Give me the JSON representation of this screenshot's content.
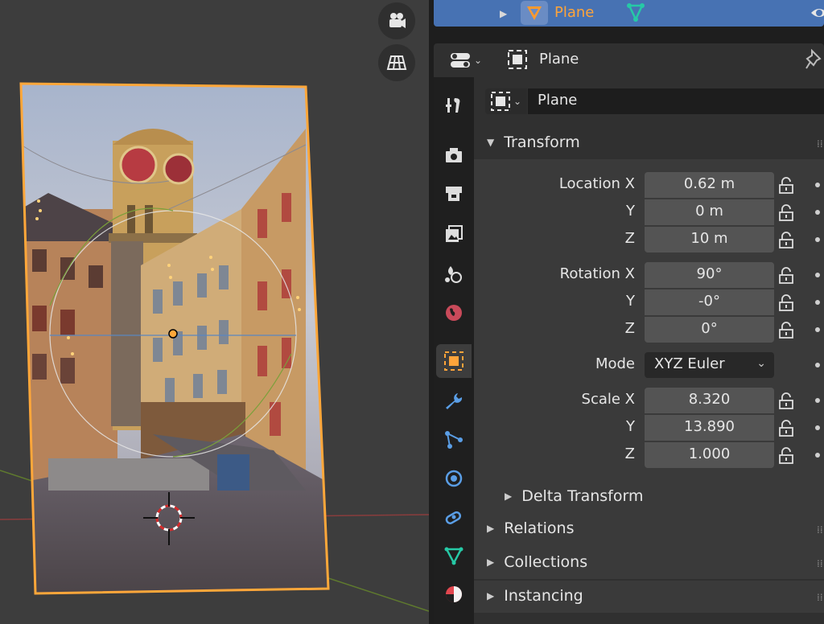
{
  "outliner": {
    "object_name": "Plane"
  },
  "properties": {
    "header_title": "Plane",
    "datablock_name": "Plane",
    "tabs": [
      "tool-icon",
      "render-icon",
      "output-icon",
      "view-layer-icon",
      "scene-icon",
      "world-icon",
      "object-icon",
      "modifier-icon",
      "particles-icon",
      "physics-icon",
      "constraints-icon",
      "object-data-icon",
      "material-icon"
    ],
    "transform": {
      "title": "Transform",
      "location": {
        "label": "Location X",
        "y_label": "Y",
        "z_label": "Z",
        "x": "0.62 m",
        "y": "0 m",
        "z": "10 m"
      },
      "rotation": {
        "label": "Rotation X",
        "y_label": "Y",
        "z_label": "Z",
        "x": "90°",
        "y": "-0°",
        "z": "0°"
      },
      "mode": {
        "label": "Mode",
        "value": "XYZ Euler"
      },
      "scale": {
        "label": "Scale X",
        "y_label": "Y",
        "z_label": "Z",
        "x": "8.320",
        "y": "13.890",
        "z": "1.000"
      },
      "delta": "Delta Transform"
    },
    "sections": [
      "Relations",
      "Collections",
      "Instancing"
    ]
  },
  "colors": {
    "selection": "#4772b3",
    "active_object": "#ffa43a",
    "mesh_green": "#26c9a6"
  }
}
